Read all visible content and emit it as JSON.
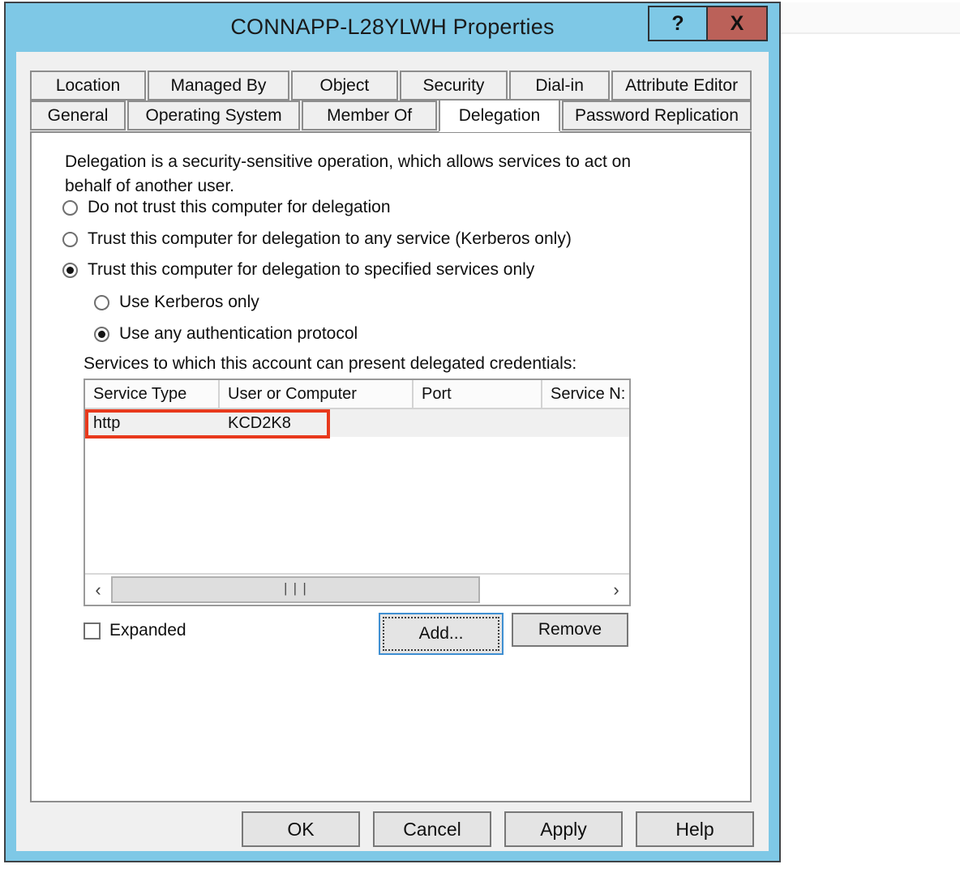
{
  "window": {
    "title": "CONNAPP-L28YLWH Properties",
    "help_button": "?",
    "close_button": "X",
    "colors": {
      "titlebar": "#7ec8e6",
      "close_button": "#bb6159",
      "annotation": "#e8391c",
      "focus_border": "#3f8fd2"
    }
  },
  "tabs": {
    "row1": [
      {
        "label": "Location",
        "selected": false
      },
      {
        "label": "Managed By",
        "selected": false
      },
      {
        "label": "Object",
        "selected": false
      },
      {
        "label": "Security",
        "selected": false
      },
      {
        "label": "Dial-in",
        "selected": false
      },
      {
        "label": "Attribute Editor",
        "selected": false
      }
    ],
    "row2": [
      {
        "label": "General",
        "selected": false
      },
      {
        "label": "Operating System",
        "selected": false
      },
      {
        "label": "Member Of",
        "selected": false
      },
      {
        "label": "Delegation",
        "selected": true
      },
      {
        "label": "Password Replication",
        "selected": false
      }
    ]
  },
  "panel": {
    "intro": "Delegation is a security-sensitive operation, which allows services to act on behalf of another user.",
    "radios": [
      {
        "label": "Do not trust this computer for delegation",
        "checked": false
      },
      {
        "label": "Trust this computer for delegation to any service (Kerberos only)",
        "checked": false
      },
      {
        "label": "Trust this computer for delegation to specified services only",
        "checked": true
      },
      {
        "label": "Use Kerberos only",
        "checked": false
      },
      {
        "label": "Use any authentication protocol",
        "checked": true
      }
    ],
    "services_label": "Services to which this account can present delegated credentials:",
    "listview": {
      "columns": [
        "Service Type",
        "User or Computer",
        "Port",
        "Service N:"
      ],
      "rows": [
        {
          "service_type": "http",
          "user_or_computer": "KCD2K8",
          "port": "",
          "service_name": "",
          "selected": true,
          "annotated": true
        }
      ],
      "scrollbar": {
        "left_arrow": "‹",
        "right_arrow": "›",
        "grip": "|||"
      }
    },
    "expanded_checkbox": {
      "label": "Expanded",
      "checked": false
    },
    "add_button": "Add...",
    "remove_button": "Remove"
  },
  "footer": {
    "ok": "OK",
    "cancel": "Cancel",
    "apply": "Apply",
    "help": "Help"
  }
}
